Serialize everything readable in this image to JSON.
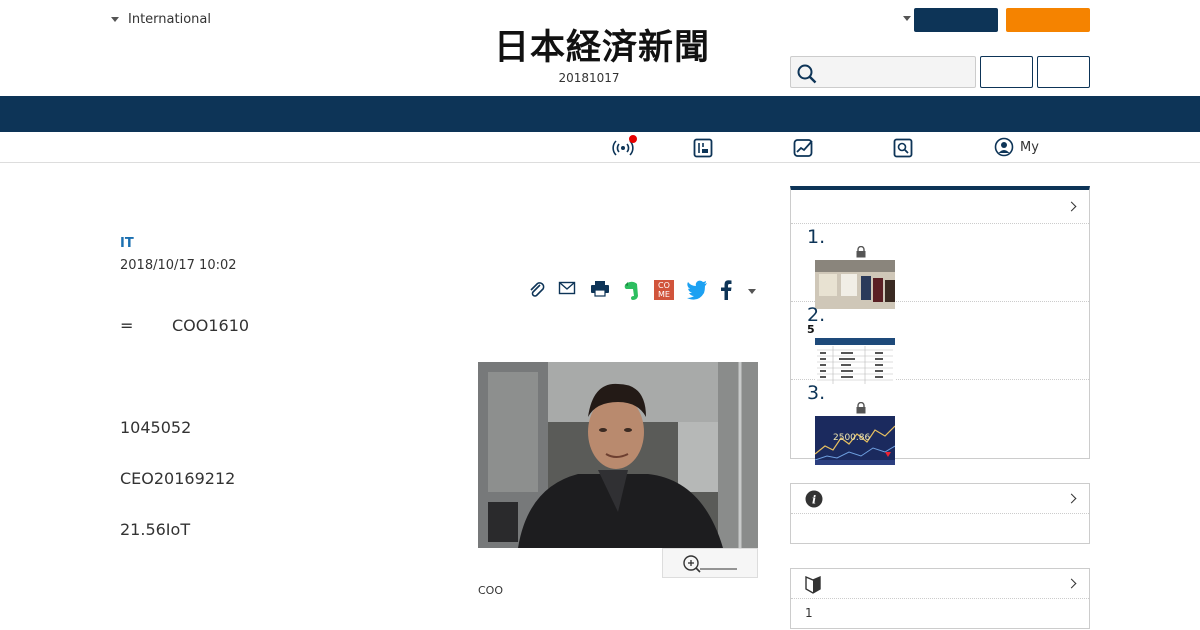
{
  "header": {
    "edition_label": "International",
    "logo_text": "日本経済新聞",
    "date": "20181017",
    "search": {
      "placeholder": "",
      "value": ""
    },
    "colors": {
      "navy": "#0d3457",
      "orange": "#f58300"
    }
  },
  "subnav": {
    "icons": [
      "live-icon",
      "newspaper-icon",
      "market-icon",
      "search-news-icon",
      "user-icon"
    ],
    "my_label": "My"
  },
  "article": {
    "category": "IT",
    "published": "2018/10/17 10:02",
    "share_icons": [
      "clip-icon",
      "mail-icon",
      "print-icon",
      "evernote-icon",
      "come-icon",
      "twitter-icon",
      "facebook-icon",
      "more-caret-icon"
    ],
    "come_label": "CO ME",
    "lead_eq": "=",
    "lead_text": "COO1610",
    "paragraphs": [
      "1045052",
      "CEO20169212",
      "21.56IoT"
    ],
    "photo_caption": "COO"
  },
  "sidebar": {
    "ranking": [
      {
        "num": "1.",
        "locked": true,
        "sub": ""
      },
      {
        "num": "2.",
        "locked": false,
        "sub": "5"
      },
      {
        "num": "3.",
        "locked": true,
        "sub": ""
      }
    ],
    "thumb3_text": "2500.86",
    "info_box": {
      "icon": "info-icon"
    },
    "beginner_box": {
      "icon": "beginner-mark-icon",
      "item": "1"
    }
  }
}
